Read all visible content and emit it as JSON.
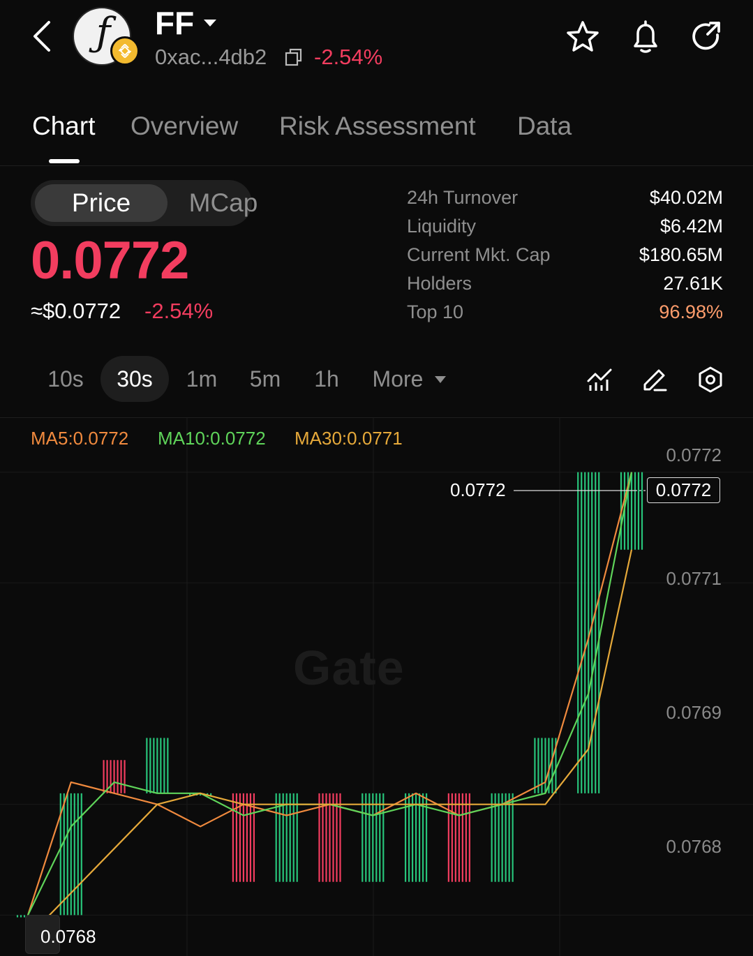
{
  "token": {
    "symbol": "FF",
    "address": "0xac...4db2",
    "change": "-2.54%"
  },
  "tabs": [
    "Chart",
    "Overview",
    "Risk Assessment",
    "Data"
  ],
  "toggle": {
    "price": "Price",
    "mcap": "MCap"
  },
  "price": {
    "value": "0.0772",
    "usd": "≈$0.0772",
    "change": "-2.54%"
  },
  "stats": [
    {
      "label": "24h  Turnover",
      "value": "$40.02M"
    },
    {
      "label": "Liquidity",
      "value": "$6.42M"
    },
    {
      "label": "Current Mkt. Cap",
      "value": "$180.65M"
    },
    {
      "label": "Holders",
      "value": "27.61K"
    },
    {
      "label": "Top 10",
      "value": "96.98%"
    }
  ],
  "timeframes": [
    "10s",
    "30s",
    "1m",
    "5m",
    "1h",
    "More"
  ],
  "chart": {
    "ma5": "MA5:0.0772",
    "ma10": "MA10:0.0772",
    "ma30": "MA30:0.0771",
    "y_ticks": [
      "0.0772",
      "0.0771",
      "0.0769",
      "0.0768"
    ],
    "last_price_label": "0.0772",
    "last_price_box": "0.0772",
    "low_label": "0.0768",
    "watermark": "Gate"
  },
  "colors": {
    "up": "#27c47a",
    "down": "#f23d5f",
    "ma5": "#f08a3e",
    "ma10": "#5fd45a",
    "ma30": "#e6a93a",
    "warn": "#ff9d6c"
  },
  "chart_data": {
    "type": "line",
    "ylim": [
      0.07677,
      0.07723
    ],
    "y_ticks": [
      0.0772,
      0.0771,
      0.0769,
      0.0768
    ],
    "candles": [
      {
        "i": 0,
        "o": 0.0768,
        "c": 0.0768,
        "h": 0.0768,
        "l": 0.0768,
        "d": "up"
      },
      {
        "i": 1,
        "o": 0.0768,
        "c": 0.07691,
        "h": 0.07691,
        "l": 0.0768,
        "d": "up"
      },
      {
        "i": 2,
        "o": 0.07691,
        "c": 0.07691,
        "h": 0.07694,
        "l": 0.07691,
        "d": "down"
      },
      {
        "i": 3,
        "o": 0.07691,
        "c": 0.07691,
        "h": 0.07696,
        "l": 0.07691,
        "d": "up"
      },
      {
        "i": 4,
        "o": 0.07691,
        "c": 0.07691,
        "h": 0.07691,
        "l": 0.07691,
        "d": "up"
      },
      {
        "i": 5,
        "o": 0.07691,
        "c": 0.07687,
        "h": 0.07691,
        "l": 0.07683,
        "d": "down"
      },
      {
        "i": 6,
        "o": 0.07687,
        "c": 0.07691,
        "h": 0.07691,
        "l": 0.07683,
        "d": "up"
      },
      {
        "i": 7,
        "o": 0.07691,
        "c": 0.07686,
        "h": 0.07691,
        "l": 0.07683,
        "d": "down"
      },
      {
        "i": 8,
        "o": 0.07686,
        "c": 0.07691,
        "h": 0.07691,
        "l": 0.07683,
        "d": "up"
      },
      {
        "i": 9,
        "o": 0.07691,
        "c": 0.07691,
        "h": 0.07691,
        "l": 0.07683,
        "d": "up"
      },
      {
        "i": 10,
        "o": 0.07691,
        "c": 0.07686,
        "h": 0.07691,
        "l": 0.07683,
        "d": "down"
      },
      {
        "i": 11,
        "o": 0.07686,
        "c": 0.07691,
        "h": 0.07691,
        "l": 0.07683,
        "d": "up"
      },
      {
        "i": 12,
        "o": 0.07691,
        "c": 0.07696,
        "h": 0.07696,
        "l": 0.07691,
        "d": "up"
      },
      {
        "i": 13,
        "o": 0.07696,
        "c": 0.0772,
        "h": 0.0772,
        "l": 0.07691,
        "d": "up"
      },
      {
        "i": 14,
        "o": 0.0772,
        "c": 0.0772,
        "h": 0.0772,
        "l": 0.07713,
        "d": "up"
      }
    ],
    "series": [
      {
        "name": "MA5",
        "values": [
          0.0768,
          0.07692,
          0.07691,
          0.0769,
          0.07688,
          0.0769,
          0.07689,
          0.0769,
          0.07689,
          0.07691,
          0.07689,
          0.0769,
          0.07692,
          0.07705,
          0.0772
        ]
      },
      {
        "name": "MA10",
        "values": [
          0.0768,
          0.07688,
          0.07692,
          0.07691,
          0.07691,
          0.07689,
          0.0769,
          0.0769,
          0.07689,
          0.0769,
          0.07689,
          0.0769,
          0.07691,
          0.077,
          0.0772
        ]
      },
      {
        "name": "MA30",
        "values": [
          0.07678,
          0.07682,
          0.07686,
          0.0769,
          0.07691,
          0.0769,
          0.0769,
          0.0769,
          0.0769,
          0.0769,
          0.0769,
          0.0769,
          0.0769,
          0.07695,
          0.07713
        ]
      }
    ]
  }
}
